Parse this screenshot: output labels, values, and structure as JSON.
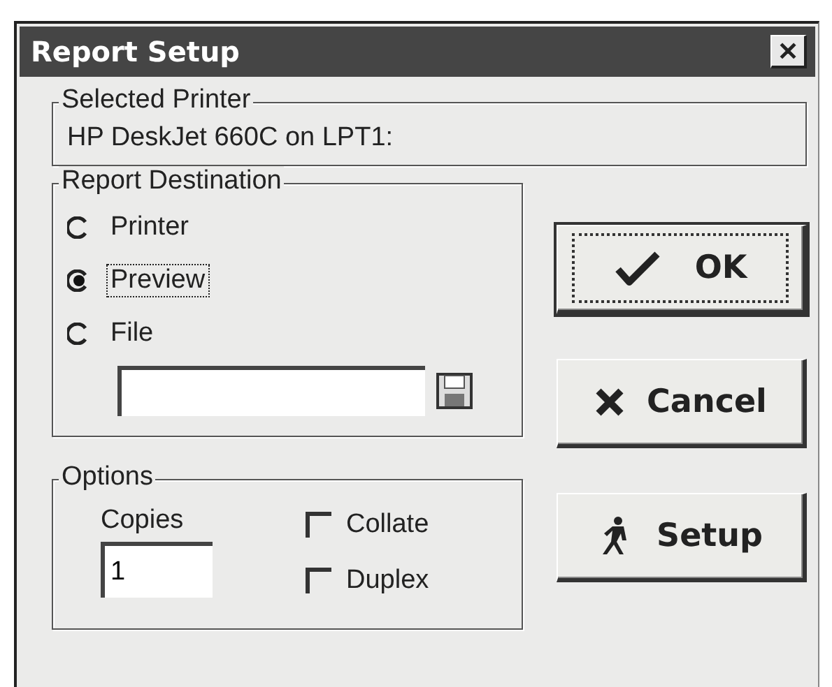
{
  "window": {
    "title": "Report Setup",
    "close_glyph": "✕"
  },
  "selected_printer": {
    "label": "Selected Printer",
    "value": "HP DeskJet 660C on LPT1:"
  },
  "report_destination": {
    "label": "Report Destination",
    "options": [
      {
        "label": "Printer",
        "selected": false
      },
      {
        "label": "Preview",
        "selected": true
      },
      {
        "label": "File",
        "selected": false
      }
    ]
  },
  "options": {
    "label": "Options",
    "copies": {
      "label": "Copies",
      "value": "1"
    },
    "checkboxes": [
      {
        "label": "Collate",
        "checked": false
      },
      {
        "label": "Duplex",
        "checked": false
      }
    ]
  },
  "buttons": [
    {
      "label": "OK",
      "kind": "ok",
      "default": true
    },
    {
      "label": "Cancel",
      "kind": "cancel",
      "default": false
    },
    {
      "label": "Setup",
      "kind": "setup",
      "default": false
    }
  ]
}
